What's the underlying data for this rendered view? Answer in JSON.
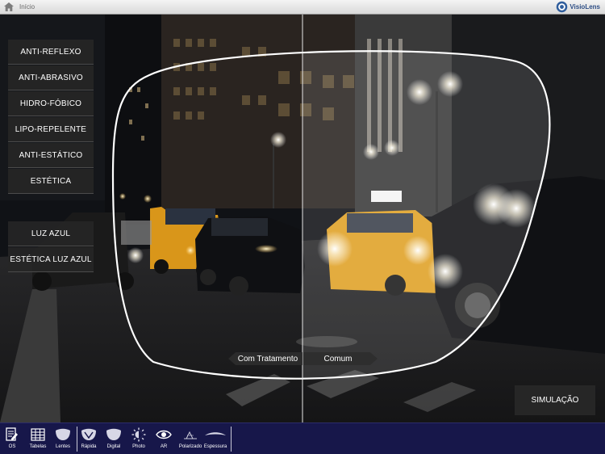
{
  "topbar": {
    "home_label": "Início",
    "brand_name": "VisioLens"
  },
  "menu": {
    "items": [
      {
        "label": "ANTI-REFLEXO"
      },
      {
        "label": "ANTI-ABRASIVO"
      },
      {
        "label": "HIDRO-FÓBICO"
      },
      {
        "label": "LIPO-REPELENTE"
      },
      {
        "label": "ANTI-ESTÁTICO"
      },
      {
        "label": "ESTÉTICA"
      },
      {
        "label": "LUZ AZUL"
      },
      {
        "label": "ESTÉTICA LUZ AZUL"
      }
    ]
  },
  "comparison": {
    "left_label": "Com Tratamento",
    "right_label": "Comum"
  },
  "simulate_label": "SIMULAÇÃO",
  "toolbar": {
    "items": [
      {
        "label": "OS",
        "icon": "document-pen-icon"
      },
      {
        "label": "Tabelas",
        "icon": "table-icon"
      },
      {
        "label": "Lentes",
        "icon": "lens-icon"
      },
      {
        "label": "Rápida",
        "icon": "quick-icon"
      },
      {
        "label": "Digital",
        "icon": "digital-lens-icon"
      },
      {
        "label": "Photo",
        "icon": "photochromic-icon"
      },
      {
        "label": "AR",
        "icon": "eye-icon"
      },
      {
        "label": "Polarizado",
        "icon": "polarized-icon"
      },
      {
        "label": "Espessura",
        "icon": "thickness-icon"
      }
    ]
  },
  "colors": {
    "toolbar_bg": "#17174a",
    "brand": "#2f4f86",
    "taxi": "#e5a21f"
  }
}
